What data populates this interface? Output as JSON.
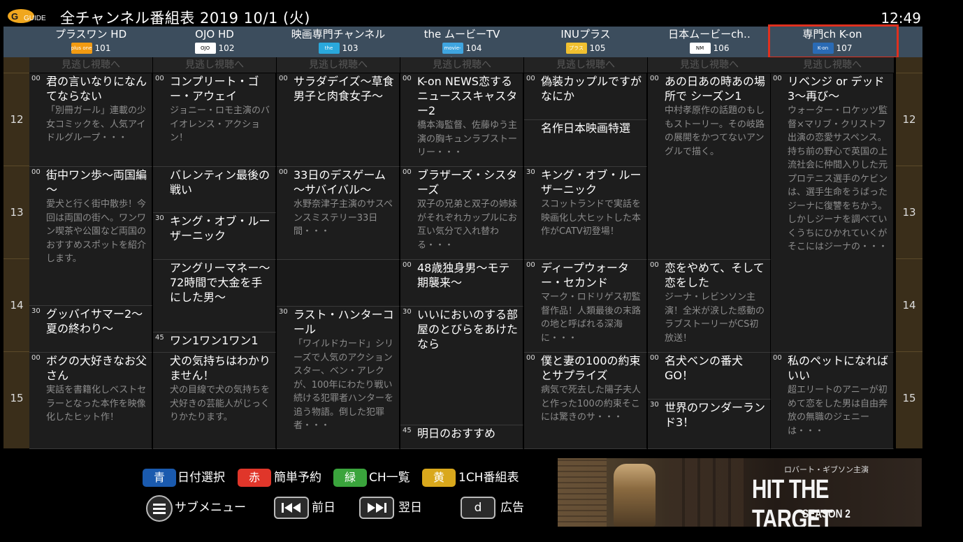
{
  "app": {
    "logo_text": "GUIDE",
    "title": "全チャンネル番組表 2019 10/1 (火)",
    "clock": "12:49"
  },
  "channels": [
    {
      "name": "プラスワン HD",
      "number": "101",
      "logo": "plus one",
      "logo_color": "#f19a12"
    },
    {
      "name": "OJO HD",
      "number": "102",
      "logo": "OJO",
      "logo_color": "#ffffff"
    },
    {
      "name": "映画専門チャンネル",
      "number": "103",
      "logo": "the MOVIE",
      "logo_color": "#2aa8dc"
    },
    {
      "name": "the ムービーTV",
      "number": "104",
      "logo": "movie-tv-icon",
      "logo_color": "#3fa5e0"
    },
    {
      "name": "INUプラス",
      "number": "105",
      "logo": "プラス",
      "logo_color": "#f0c030"
    },
    {
      "name": "日本ムービーch‥",
      "number": "106",
      "logo": "NM",
      "logo_color": "#ffffff"
    },
    {
      "name": "専門ch K-on",
      "number": "107",
      "logo": "K-on",
      "logo_color": "#2a6bb5"
    }
  ],
  "missed_label": "見逃し視聴へ",
  "hours": [
    "12",
    "13",
    "14",
    "15"
  ],
  "programs": [
    [
      {
        "min": "00",
        "title": "君の言いなりになんてならない",
        "desc": "「別冊ガール」連載の少女コミックを、人気アイドルグループ・・・"
      },
      {
        "min": "00",
        "title": "街中ワン歩～両国編～",
        "desc": "愛犬と行く街中散歩！今回は両国の街へ。ワンワン喫茶や公園など両国のおすすめスポットを紹介します。"
      },
      {
        "min": "30",
        "title": "グッバイサマー2～夏の終わり～",
        "desc": ""
      },
      {
        "min": "00",
        "title": "ボクの大好きなお父さん",
        "desc": "実話を書籍化しベストセラーとなった本作を映像化したヒット作！"
      }
    ],
    [
      {
        "min": "00",
        "title": "コンプリート・ゴー・アウェイ",
        "desc": "ジョニー・ロモ主演のバイオレンス・アクション！"
      },
      {
        "min": "",
        "title": "バレンティン最後の戦い",
        "desc": ""
      },
      {
        "min": "30",
        "title": "キング・オブ・ルーザーニック",
        "desc": ""
      },
      {
        "min": "",
        "title": "アングリーマネー～72時間で大金を手にした男～",
        "desc": ""
      },
      {
        "min": "45",
        "title": "ワン1ワン1ワン1",
        "desc": ""
      },
      {
        "min": "",
        "title": "犬の気持ちはわかりません！",
        "desc": "犬の目線で犬の気持ちを犬好きの芸能人がじっくりかたります。"
      }
    ],
    [
      {
        "min": "00",
        "title": "サラダデイズ～草食男子と肉食女子～",
        "desc": ""
      },
      {
        "min": "00",
        "title": "33日のデスゲーム～サバイバル～",
        "desc": "水野奈津子主演のサスペンスミステリー33日間・・・"
      },
      {
        "min": "",
        "title": "",
        "desc": ""
      },
      {
        "min": "30",
        "title": "ラスト・ハンターコール",
        "desc": "「ワイルドカード」シリーズで人気のアクションスター、ベン・アレクが、100年にわたり戦い続ける犯罪者ハンターを追う物語。倒した犯罪者・・・"
      }
    ],
    [
      {
        "min": "00",
        "title": "K-on NEWS恋するニューススキャスター2",
        "desc": "橋本海監督、佐藤ゆう主演の胸キュンラブストーリー・・・"
      },
      {
        "min": "00",
        "title": "ブラザーズ・シスターズ",
        "desc": "双子の兄弟と双子の姉妹がそれぞれカップルにお互い気分で入れ替わる・・・"
      },
      {
        "min": "00",
        "title": "48歳独身男～モテ期襲来～",
        "desc": ""
      },
      {
        "min": "30",
        "title": "いいにおいのする部屋のとびらをあけたなら",
        "desc": ""
      },
      {
        "min": "45",
        "title": "明日のおすすめ",
        "desc": ""
      }
    ],
    [
      {
        "min": "00",
        "title": "偽装カップルですがなにか",
        "desc": ""
      },
      {
        "min": "",
        "title": "名作日本映画特選",
        "desc": ""
      },
      {
        "min": "30",
        "title": "キング・オブ・ルーザーニック",
        "desc": "スコットランドで実話を映画化し大ヒットした本作がCATV初登場！"
      },
      {
        "min": "00",
        "title": "ディープウォーター・セカンド",
        "desc": "マーク・ロドリゲス初監督作品！人類最後の末路の地と呼ばれる深海に・・・"
      },
      {
        "min": "00",
        "title": "僕と妻の100の約束とサプライズ",
        "desc": "病気で死去した陽子夫人と作った100の約束そこには驚きのサ・・・"
      }
    ],
    [
      {
        "min": "00",
        "title": "あの日あの時あの場所で シーズン1",
        "desc": "中村孝原作の話題のもしもストーリー。その岐路の展開をかつてないアングルで描く。"
      },
      {
        "min": "00",
        "title": "恋をやめて、そして恋をした",
        "desc": "ジーナ・レビンソン主演！全米が涙した感動のラブストーリーがCS初放送！"
      },
      {
        "min": "00",
        "title": "名犬ベンの番犬GO！",
        "desc": ""
      },
      {
        "min": "30",
        "title": "世界のワンダーランド3！",
        "desc": ""
      }
    ],
    [
      {
        "min": "00",
        "title": "リベンジ or デッド3～再び～",
        "desc": "ウォーター・ロケッツ監督×マリブ・クリストフ出演の恋愛サスペンス。持ち前の野心で英国の上流社会に仲間入りした元プロテニス選手のケビンは、選手生命をうばったジーナに復讐をちかう。しかしジーナを調べていくうちにひかれていくがそこにはジーナの・・・"
      },
      {
        "min": "00",
        "title": "私のペットになればいい",
        "desc": "超エリートのアニーが初めて恋をした男は自由奔放の無職のジェニーは・・・"
      }
    ]
  ],
  "footer": {
    "blue_key": "青",
    "blue_label": "日付選択",
    "red_key": "赤",
    "red_label": "簡単予約",
    "green_key": "緑",
    "green_label": "CH一覧",
    "yellow_key": "黄",
    "yellow_label": "1CH番組表",
    "submenu_label": "サブメニュー",
    "prev_label": "前日",
    "next_label": "翌日",
    "d_key": "d",
    "ad_label": "広告",
    "colors": {
      "blue": "#1a5aae",
      "red": "#e0362a",
      "green": "#3aa43c",
      "yellow": "#d9a81c"
    }
  },
  "ad": {
    "actor": "ロバート・ギブソン主演",
    "title": "HIT THE TARGET",
    "season": "SEASON 2"
  }
}
